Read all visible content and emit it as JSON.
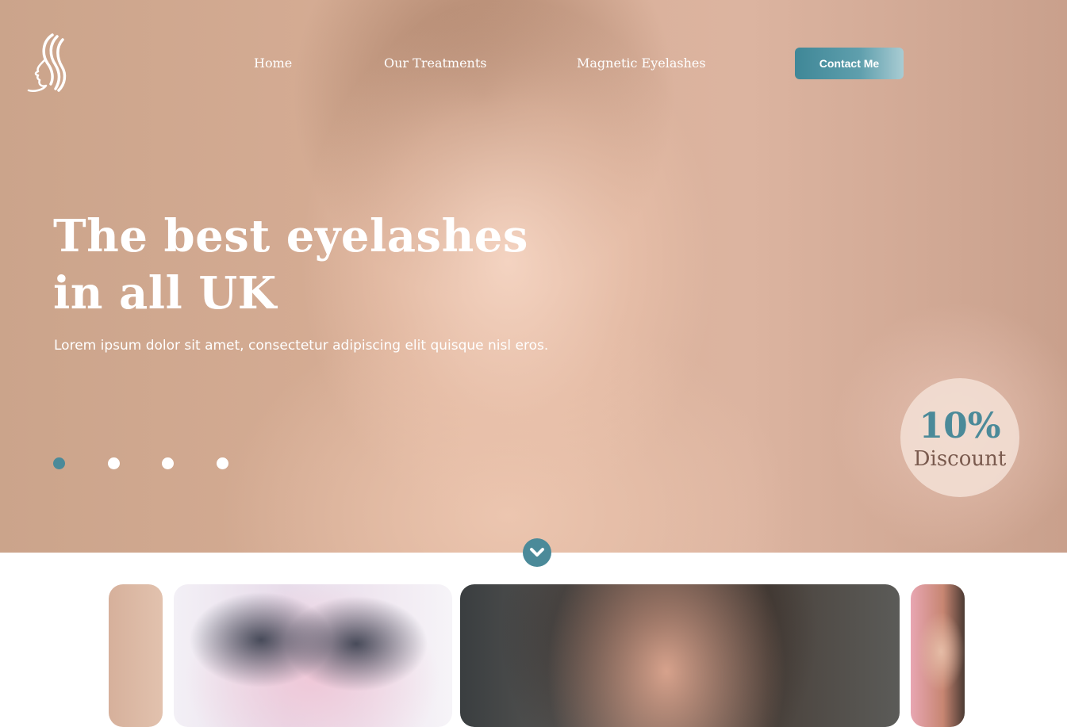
{
  "nav": {
    "items": [
      {
        "label": "Home"
      },
      {
        "label": "Our Treatments"
      },
      {
        "label": "Magnetic Eyelashes"
      }
    ],
    "contact_label": "Contact Me"
  },
  "hero": {
    "headline_line1": "The best eyelashes",
    "headline_line2": "in all UK",
    "subtitle": "Lorem ipsum dolor sit amet, consectetur adipiscing elit quisque nisl eros.",
    "slides": {
      "count": 4,
      "active": 1
    }
  },
  "badge": {
    "value": "10%",
    "label": "Discount"
  },
  "icons": {
    "logo": "woman-face-logo",
    "scroll": "chevron-down-icon"
  },
  "colors": {
    "accent": "#4b8a99",
    "hero_background": "#d6ad95",
    "text_light": "#ffffff"
  }
}
